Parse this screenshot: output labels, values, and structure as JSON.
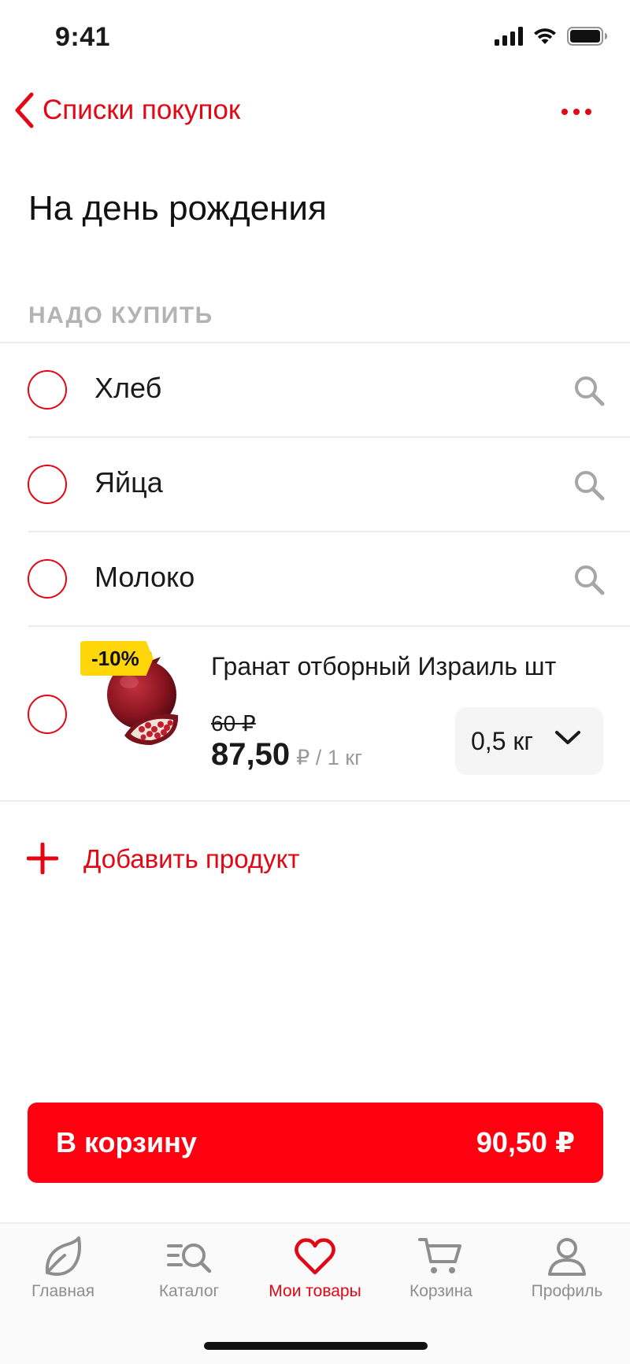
{
  "status": {
    "time": "9:41"
  },
  "nav": {
    "back_label": "Списки покупок"
  },
  "page": {
    "title": "На день рождения"
  },
  "section": {
    "header": "НАДО КУПИТЬ"
  },
  "items": [
    {
      "label": "Хлеб"
    },
    {
      "label": "Яйца"
    },
    {
      "label": "Молоко"
    }
  ],
  "product": {
    "badge": "-10%",
    "name": "Гранат отборный Израиль шт",
    "old_price": "60 ₽",
    "new_price": "87,50",
    "unit": "₽ / 1 кг",
    "quantity": "0,5 кг"
  },
  "add_product_label": "Добавить продукт",
  "cart_button": {
    "label": "В корзину",
    "total": "90,50 ₽"
  },
  "tabs": [
    {
      "label": "Главная",
      "icon": "leaf-icon",
      "active": false
    },
    {
      "label": "Каталог",
      "icon": "catalog-search-icon",
      "active": false
    },
    {
      "label": "Мои товары",
      "icon": "heart-icon",
      "active": true
    },
    {
      "label": "Корзина",
      "icon": "cart-icon",
      "active": false
    },
    {
      "label": "Профиль",
      "icon": "profile-icon",
      "active": false
    }
  ],
  "colors": {
    "accent": "#e30613",
    "button": "#ff0011",
    "badge": "#ffd60a"
  }
}
